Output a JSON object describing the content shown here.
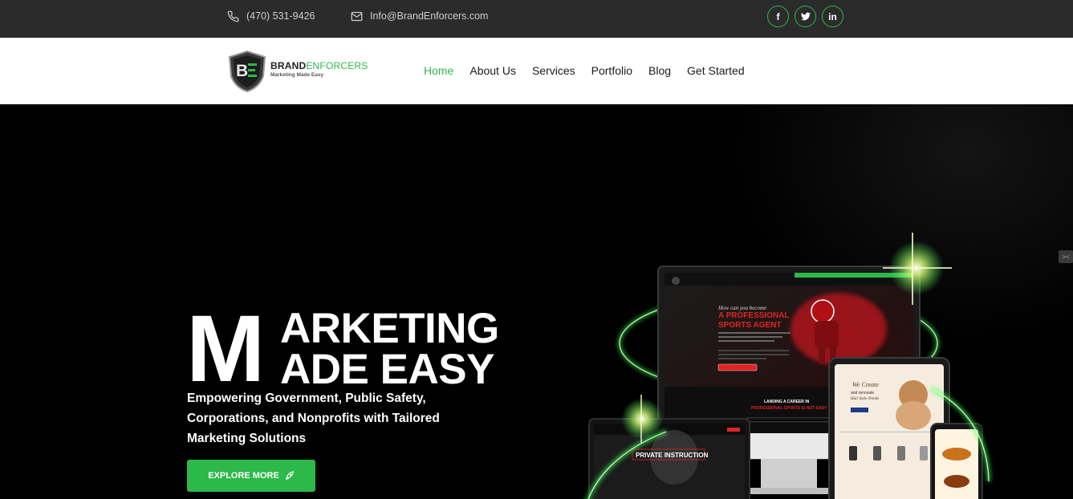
{
  "topbar": {
    "phone": "(470) 531-9426",
    "email": "Info@BrandEnforcers.com",
    "socials": [
      {
        "label": "f",
        "icon": "facebook-icon"
      },
      {
        "label": "t",
        "icon": "twitter-icon"
      },
      {
        "label": "in",
        "icon": "linkedin-icon"
      }
    ]
  },
  "header": {
    "logo": {
      "brand_bold": "BRAND",
      "brand_light": "ENFORCERS",
      "tagline": "Marketing Made Easy",
      "shield_letters": "BE"
    },
    "nav": [
      {
        "label": "Home",
        "active": true
      },
      {
        "label": "About Us",
        "active": false
      },
      {
        "label": "Services",
        "active": false
      },
      {
        "label": "Portfolio",
        "active": false
      },
      {
        "label": "Blog",
        "active": false
      },
      {
        "label": "Get Started",
        "active": false
      }
    ]
  },
  "hero": {
    "big_letter": "M",
    "line1": "ARKETING",
    "line2": "ADE EASY",
    "subtitle": "Empowering Government, Public Safety, Corporations, and Nonprofits with Tailored Marketing Solutions",
    "cta_label": "EXPLORE MORE",
    "cta_icon": "rocket-icon",
    "side_button": "><"
  },
  "devices": {
    "desktop_headline": "A PROFESSIONAL SPORTS AGENT",
    "desktop_script": "How can you become",
    "desktop_sub": "AND WORK WITH WORLD-CLASS SUPERSTAR ATHLETES WITHOUT A DEGREE OR MBA",
    "desktop_cta": "GET INSTANT ACCESS",
    "desktop_footer": "LANDING A CAREER IN PROFESSIONAL SPORTS IS NOT EASY",
    "laptop_title": "PRIVATE INSTRUCTION",
    "tablet_title": "We Create and renovate Hair Style Trends",
    "colors": {
      "accent": "#2db84a",
      "red": "#e02424",
      "glow": "#3dff5a"
    }
  }
}
